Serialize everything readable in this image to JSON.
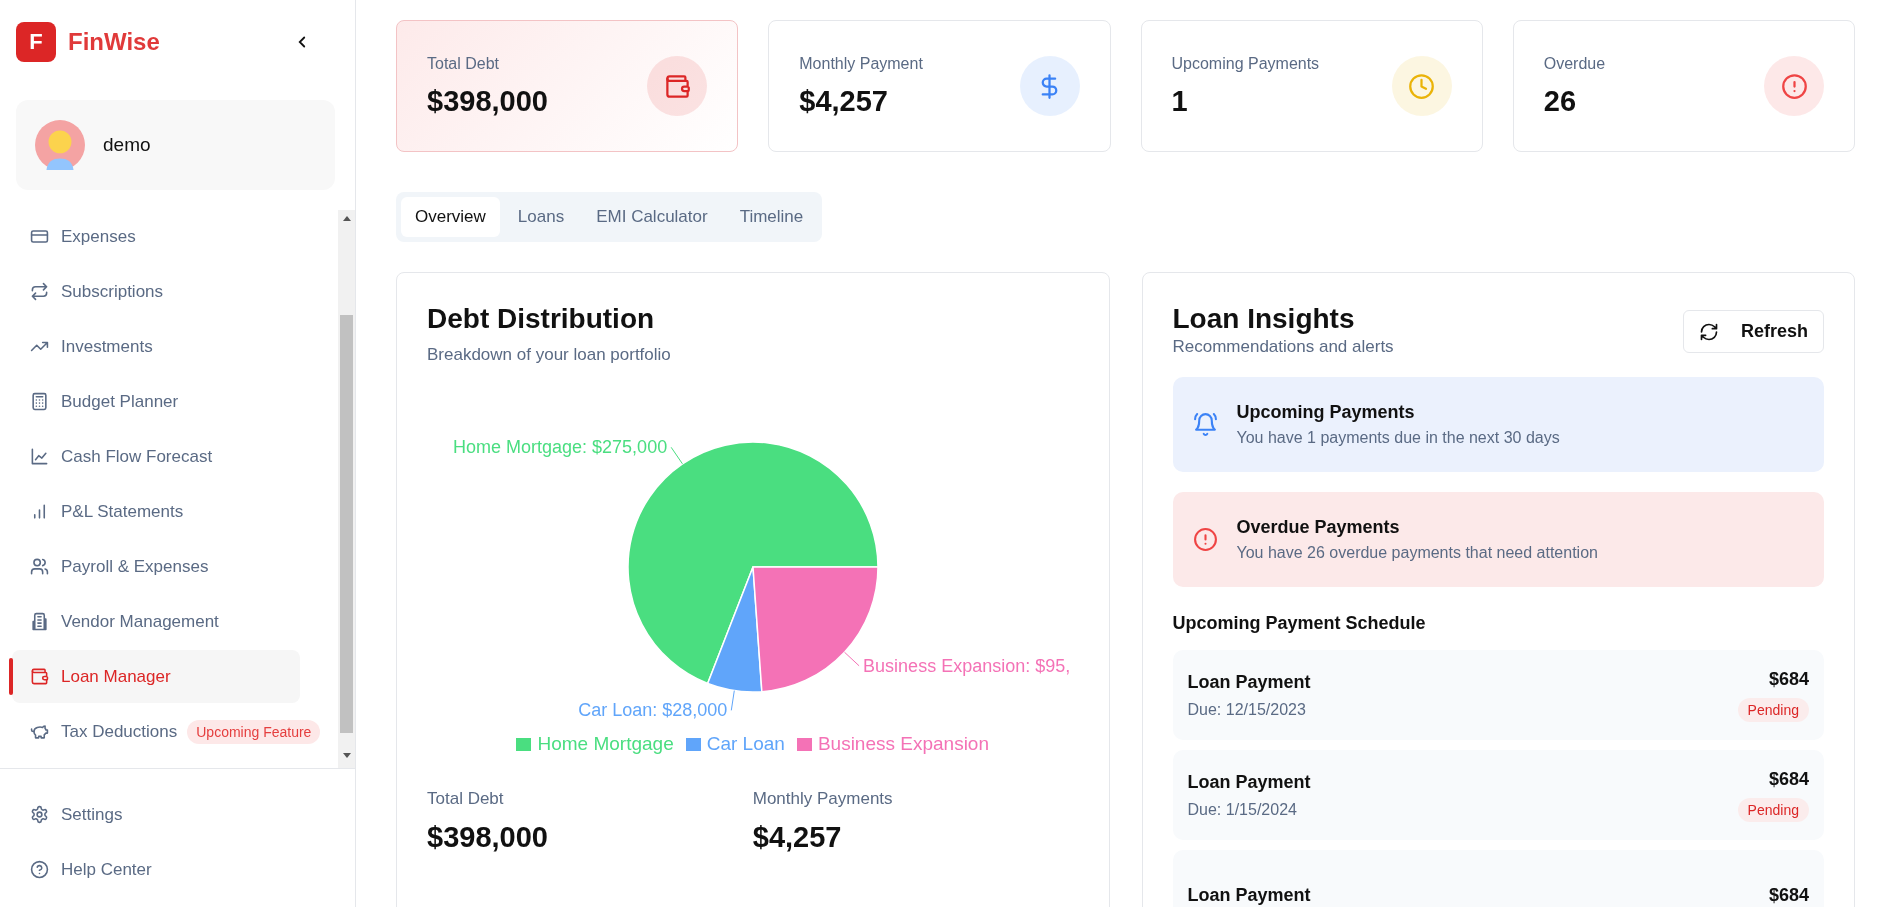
{
  "brand": {
    "logo_letter": "F",
    "name": "FinWise"
  },
  "user": {
    "name": "demo"
  },
  "nav": [
    {
      "label": "Expenses",
      "selected": false
    },
    {
      "label": "Subscriptions",
      "selected": false
    },
    {
      "label": "Investments",
      "selected": false
    },
    {
      "label": "Budget Planner",
      "selected": false
    },
    {
      "label": "Cash Flow Forecast",
      "selected": false
    },
    {
      "label": "P&L Statements",
      "selected": false
    },
    {
      "label": "Payroll & Expenses",
      "selected": false
    },
    {
      "label": "Vendor Management",
      "selected": false
    },
    {
      "label": "Loan Manager",
      "selected": true
    },
    {
      "label": "Tax Deductions",
      "selected": false,
      "badge": "Upcoming Feature"
    }
  ],
  "footer_nav": [
    {
      "label": "Settings"
    },
    {
      "label": "Help Center"
    }
  ],
  "stats": [
    {
      "label": "Total Debt",
      "value": "$398,000",
      "color": "#dc2626",
      "highlighted": true
    },
    {
      "label": "Monthly Payment",
      "value": "$4,257",
      "color": "#3b82f6",
      "highlighted": false
    },
    {
      "label": "Upcoming Payments",
      "value": "1",
      "color": "#eab308",
      "highlighted": false
    },
    {
      "label": "Overdue",
      "value": "26",
      "color": "#ef4444",
      "highlighted": false
    }
  ],
  "tabs": [
    {
      "label": "Overview",
      "selected": true
    },
    {
      "label": "Loans",
      "selected": false
    },
    {
      "label": "EMI Calculator",
      "selected": false
    },
    {
      "label": "Timeline",
      "selected": false
    }
  ],
  "debt_distribution": {
    "title": "Debt Distribution",
    "subtitle": "Breakdown of your loan portfolio",
    "chart_data": {
      "type": "pie",
      "categories": [
        "Home Mortgage",
        "Car Loan",
        "Business Expansion"
      ],
      "values": [
        69.09,
        7.04,
        23.87
      ],
      "colors": [
        "#4ade80",
        "#60a5fa",
        "#f472b6"
      ],
      "legend": "bottom"
    },
    "slice_labels": [
      "Home Mortgage: $275,000",
      "Car Loan: $28,000",
      "Business Expansion: $95,"
    ],
    "totals": [
      {
        "label": "Total Debt",
        "value": "$398,000"
      },
      {
        "label": "Monthly Payments",
        "value": "$4,257"
      }
    ]
  },
  "insights": {
    "title": "Loan Insights",
    "subtitle": "Recommendations and alerts",
    "refresh_button": "Refresh",
    "alerts": [
      {
        "kind": "info",
        "title": "Upcoming Payments",
        "text": "You have 1 payments due in the next 30 days"
      },
      {
        "kind": "danger",
        "title": "Overdue Payments",
        "text": "You have 26 overdue payments that need attention"
      }
    ],
    "schedule_title": "Upcoming Payment Schedule",
    "schedule": [
      {
        "title": "Loan Payment",
        "due": "Due: 12/15/2023",
        "amount": "$684",
        "status": "Pending"
      },
      {
        "title": "Loan Payment",
        "due": "Due: 1/15/2024",
        "amount": "$684",
        "status": "Pending"
      },
      {
        "title": "Loan Payment",
        "amount": "$684"
      }
    ]
  }
}
